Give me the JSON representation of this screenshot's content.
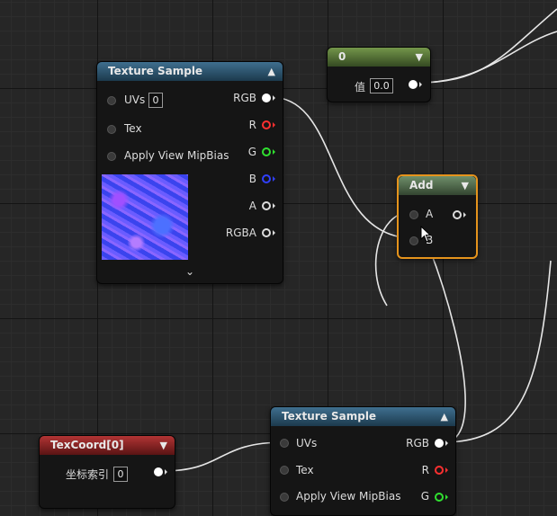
{
  "colors": {
    "wire": "#e6e6e6",
    "pin_r": "#ff3030",
    "pin_g": "#30e030",
    "pin_b": "#3040ff",
    "selected_border": "#e5931c"
  },
  "texture_sample_top": {
    "title": "Texture Sample",
    "uvs_label": "UVs",
    "uvs_value": "0",
    "tex_label": "Tex",
    "mip_label": "Apply View MipBias",
    "out_rgb": "RGB",
    "out_r": "R",
    "out_g": "G",
    "out_b": "B",
    "out_a": "A",
    "out_rgba": "RGBA"
  },
  "constant_node": {
    "title": "0",
    "value_label": "值",
    "value": "0.0"
  },
  "add_node": {
    "title": "Add",
    "in_a": "A",
    "in_b": "B"
  },
  "texcoord_node": {
    "title": "TexCoord[0]",
    "index_label": "坐标索引",
    "index_value": "0"
  },
  "texture_sample_bottom": {
    "title": "Texture Sample",
    "uvs_label": "UVs",
    "tex_label": "Tex",
    "mip_label": "Apply View MipBias",
    "out_rgb": "RGB",
    "out_r": "R",
    "out_g": "G"
  }
}
